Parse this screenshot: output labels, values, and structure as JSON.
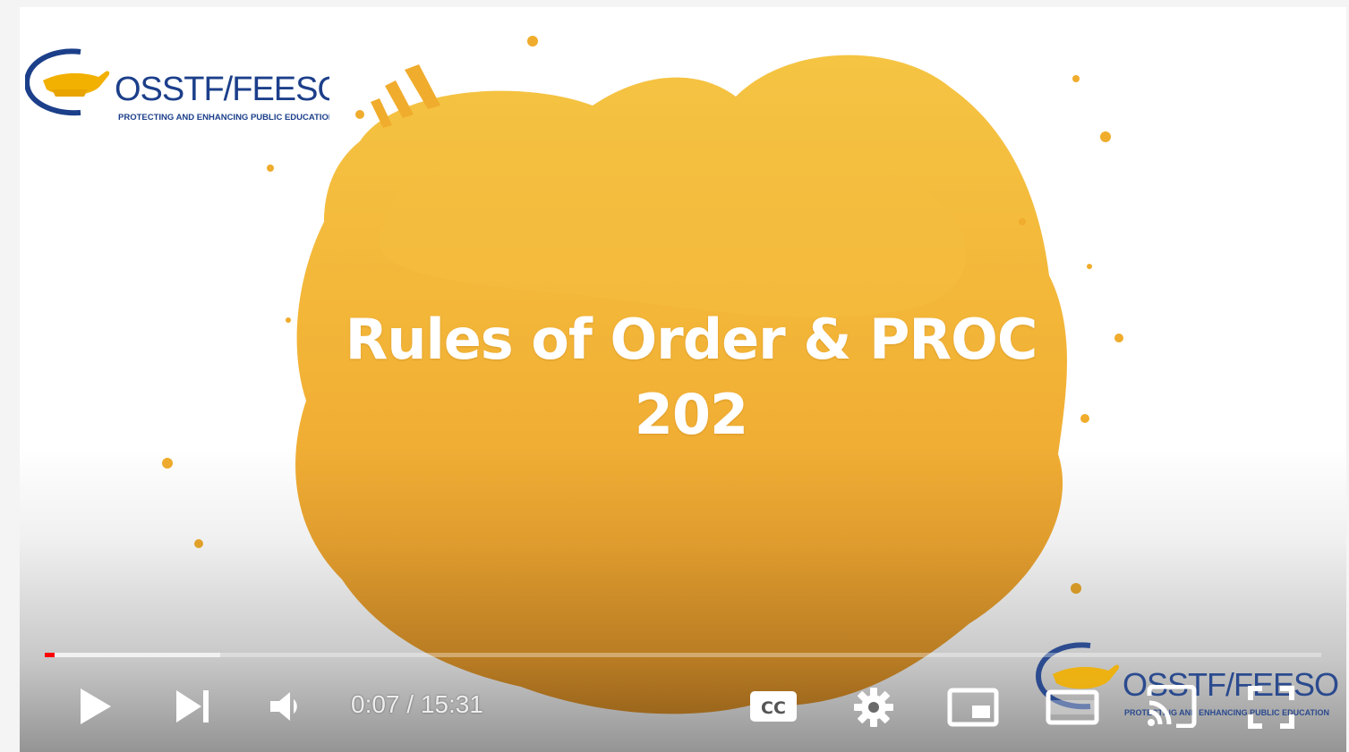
{
  "logo": {
    "wordmark": "OSSTF/FEESO",
    "tagline": "PROTECTING AND ENHANCING PUBLIC EDUCATION"
  },
  "video": {
    "title_line1": "Rules of Order & PROC",
    "title_line2": "202",
    "progress_fraction": 0.0075
  },
  "controls": {
    "current_time": "0:07",
    "separator": " / ",
    "duration": "15:31",
    "cc_label": "CC",
    "icons": [
      "play-icon",
      "next-icon",
      "volume-icon",
      "captions-icon",
      "settings-gear-icon",
      "miniplayer-icon",
      "theater-mode-icon",
      "cast-icon",
      "fullscreen-icon"
    ]
  },
  "colors": {
    "splash_orange": "#f0ac2c",
    "splash_light": "#f4bf44",
    "brand_blue": "#1c3f8a",
    "progress_red": "#ff0000"
  }
}
